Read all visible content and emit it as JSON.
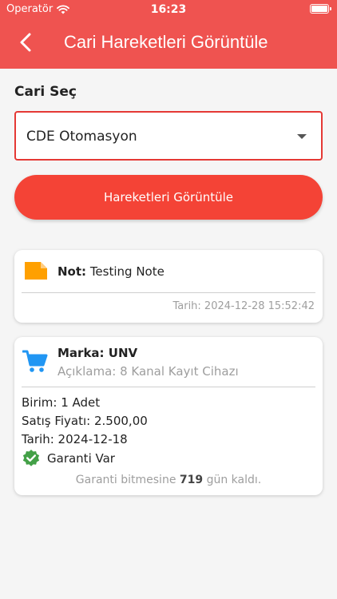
{
  "status_bar": {
    "carrier": "Operatör",
    "time": "16:23"
  },
  "app_bar": {
    "title": "Cari Hareketleri Görüntüle"
  },
  "form": {
    "label": "Cari Seç",
    "selected_value": "CDE Otomasyon",
    "button_label": "Hareketleri Görüntüle"
  },
  "note_card": {
    "label": "Not:",
    "text": "Testing Note",
    "date": "Tarih: 2024-12-28 15:52:42"
  },
  "product_card": {
    "brand": "Marka: UNV",
    "description": "Açıklama: 8 Kanal Kayıt Cihazı",
    "unit": "Birim: 1 Adet",
    "price": "Satış Fiyatı: 2.500,00",
    "date": "Tarih: 2024-12-18",
    "warranty_status": "Garanti Var",
    "warranty_prefix": "Garanti bitmesine",
    "warranty_days": "719",
    "warranty_suffix": "gün kaldı."
  },
  "colors": {
    "app_bar": "#ef5350",
    "primary_button": "#f44336",
    "select_border": "#e53935",
    "note_icon": "#ffa000",
    "cart_icon": "#2196f3",
    "check_icon": "#43a047"
  },
  "icons": {
    "back": "back-arrow-icon",
    "note": "note-icon",
    "cart": "shopping-cart-icon",
    "warranty": "verified-check-icon",
    "dropdown": "caret-down-icon"
  }
}
